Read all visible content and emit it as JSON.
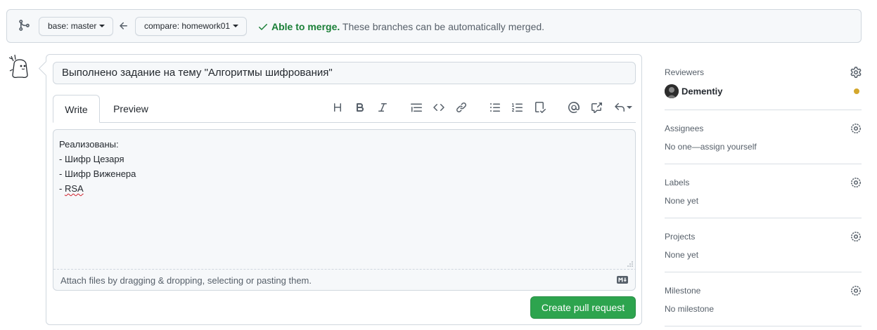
{
  "compare": {
    "base_prefix": "base:",
    "base_branch": "master",
    "compare_prefix": "compare:",
    "compare_branch": "homework01",
    "merge_ok": "Able to merge.",
    "merge_msg": "These branches can be automatically merged."
  },
  "form": {
    "title_value": "Выполнено задание на тему \"Алгоритмы шифрования\"",
    "tab_write": "Write",
    "tab_preview": "Preview",
    "body_lines": [
      "Реализованы:",
      "- Шифр Цезаря",
      "- Шифр Виженера",
      "- "
    ],
    "body_misspelled": "RSA",
    "attach_hint": "Attach files by dragging & dropping, selecting or pasting them.",
    "submit_label": "Create pull request"
  },
  "toolbar": {
    "icons": [
      "heading-icon",
      "bold-icon",
      "italic-icon",
      "quote-icon",
      "code-icon",
      "link-icon",
      "unordered-list-icon",
      "ordered-list-icon",
      "task-list-icon",
      "mention-icon",
      "cross-reference-icon",
      "saved-replies-icon"
    ]
  },
  "sidebar": {
    "reviewers_label": "Reviewers",
    "reviewer_name": "Dementiy",
    "assignees_label": "Assignees",
    "assignees_value": "No one—assign yourself",
    "labels_label": "Labels",
    "labels_value": "None yet",
    "projects_label": "Projects",
    "projects_value": "None yet",
    "milestone_label": "Milestone",
    "milestone_value": "No milestone"
  },
  "colors": {
    "success": "#1a7f37",
    "primary_button": "#2da44e",
    "pending": "#d4a72c",
    "muted_text": "#57606a",
    "border": "#d0d7de"
  }
}
